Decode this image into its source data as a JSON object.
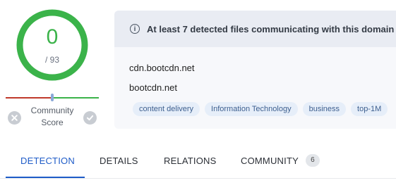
{
  "score": {
    "value": "0",
    "total": "/ 93",
    "community_label_line1": "Community",
    "community_label_line2": "Score",
    "ring_color": "#3bb34a",
    "bar_colors": {
      "negative": "#c0392b",
      "positive": "#3bb34a"
    }
  },
  "banner": {
    "icon": "info-icon",
    "text": "At least 7 detected files communicating with this domain"
  },
  "domains": [
    "cdn.bootcdn.net",
    "bootcdn.net"
  ],
  "tags": [
    "content delivery",
    "Information Technology",
    "business",
    "top-1M"
  ],
  "tabs": [
    {
      "label": "DETECTION",
      "active": true
    },
    {
      "label": "DETAILS",
      "active": false
    },
    {
      "label": "RELATIONS",
      "active": false
    },
    {
      "label": "COMMUNITY",
      "active": false,
      "badge": "6"
    }
  ],
  "colors": {
    "accent": "#1f5cc8",
    "tag_bg": "#e6eef9",
    "tag_text": "#3d5f8f"
  }
}
